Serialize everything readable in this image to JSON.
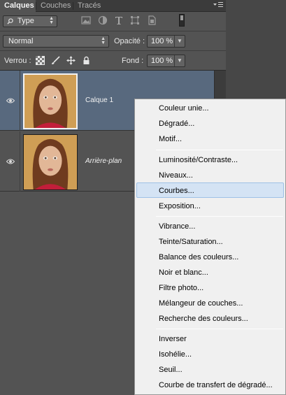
{
  "tabs": [
    {
      "label": "Calques",
      "active": true
    },
    {
      "label": "Couches",
      "active": false
    },
    {
      "label": "Tracés",
      "active": false
    }
  ],
  "panel_menu_icon": "panel-menu-icon",
  "filter": {
    "kind_value": "Type",
    "icons": [
      "image-filter-icon",
      "adjustment-filter-icon",
      "text-filter-icon",
      "shape-filter-icon",
      "smart-object-filter-icon"
    ]
  },
  "blend": {
    "mode_value": "Normal",
    "opacity_label": "Opacité :",
    "opacity_value": "100 %"
  },
  "lock": {
    "label": "Verrou :",
    "icons": [
      "lock-transparent-pixels-icon",
      "lock-image-pixels-icon",
      "lock-position-icon",
      "lock-all-icon"
    ],
    "fill_label": "Fond :",
    "fill_value": "100 %"
  },
  "layers": [
    {
      "name": "Calque 1",
      "selected": true,
      "italic": false
    },
    {
      "name": "Arrière-plan",
      "selected": false,
      "italic": true
    }
  ],
  "context_menu": {
    "highlighted": "Courbes...",
    "groups": [
      [
        "Couleur unie...",
        "Dégradé...",
        "Motif..."
      ],
      [
        "Luminosité/Contraste...",
        "Niveaux...",
        "Courbes...",
        "Exposition..."
      ],
      [
        "Vibrance...",
        "Teinte/Saturation...",
        "Balance des couleurs...",
        "Noir et blanc...",
        "Filtre photo...",
        "Mélangeur de couches...",
        "Recherche des couleurs..."
      ],
      [
        "Inverser",
        "Isohélie...",
        "Seuil...",
        "Courbe de transfert de dégradé..."
      ]
    ]
  },
  "colors": {
    "panel_bg": "#535353",
    "selected_layer": "#58697e",
    "menu_highlight": "#d4e3f4"
  }
}
